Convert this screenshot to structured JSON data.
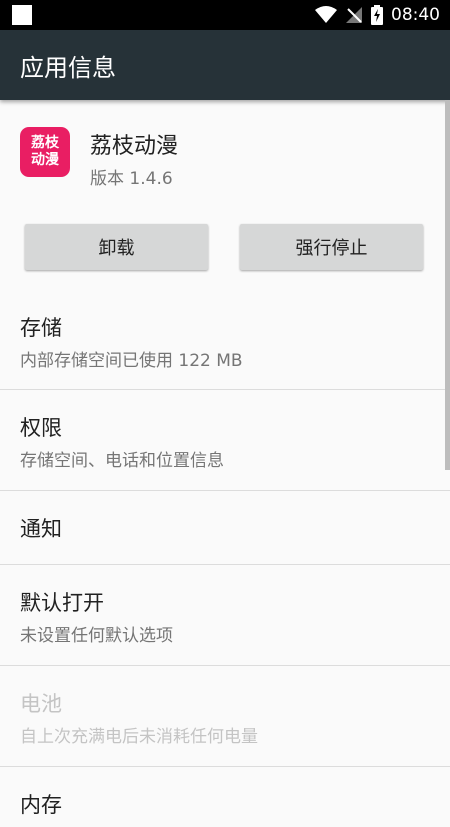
{
  "status_bar": {
    "time": "08:40",
    "icons": [
      "notification-square-icon",
      "wifi-icon",
      "no-signal-icon",
      "battery-charging-icon"
    ]
  },
  "app_bar": {
    "title": "应用信息"
  },
  "app": {
    "icon_text_line1": "荔枝",
    "icon_text_line2": "动漫",
    "name": "荔枝动漫",
    "version": "版本 1.4.6"
  },
  "buttons": {
    "uninstall": "卸载",
    "force_stop": "强行停止"
  },
  "items": [
    {
      "title": "存储",
      "subtitle": "内部存储空间已使用 122 MB"
    },
    {
      "title": "权限",
      "subtitle": "存储空间、电话和位置信息"
    },
    {
      "title": "通知"
    },
    {
      "title": "默认打开",
      "subtitle": "未设置任何默认选项"
    },
    {
      "title": "电池",
      "subtitle": "自上次充满电后未消耗任何电量"
    },
    {
      "title": "内存"
    }
  ],
  "colors": {
    "app_bar": "#263238",
    "app_icon": "#e91e63",
    "background": "#fafafa",
    "button": "#d6d7d7"
  }
}
